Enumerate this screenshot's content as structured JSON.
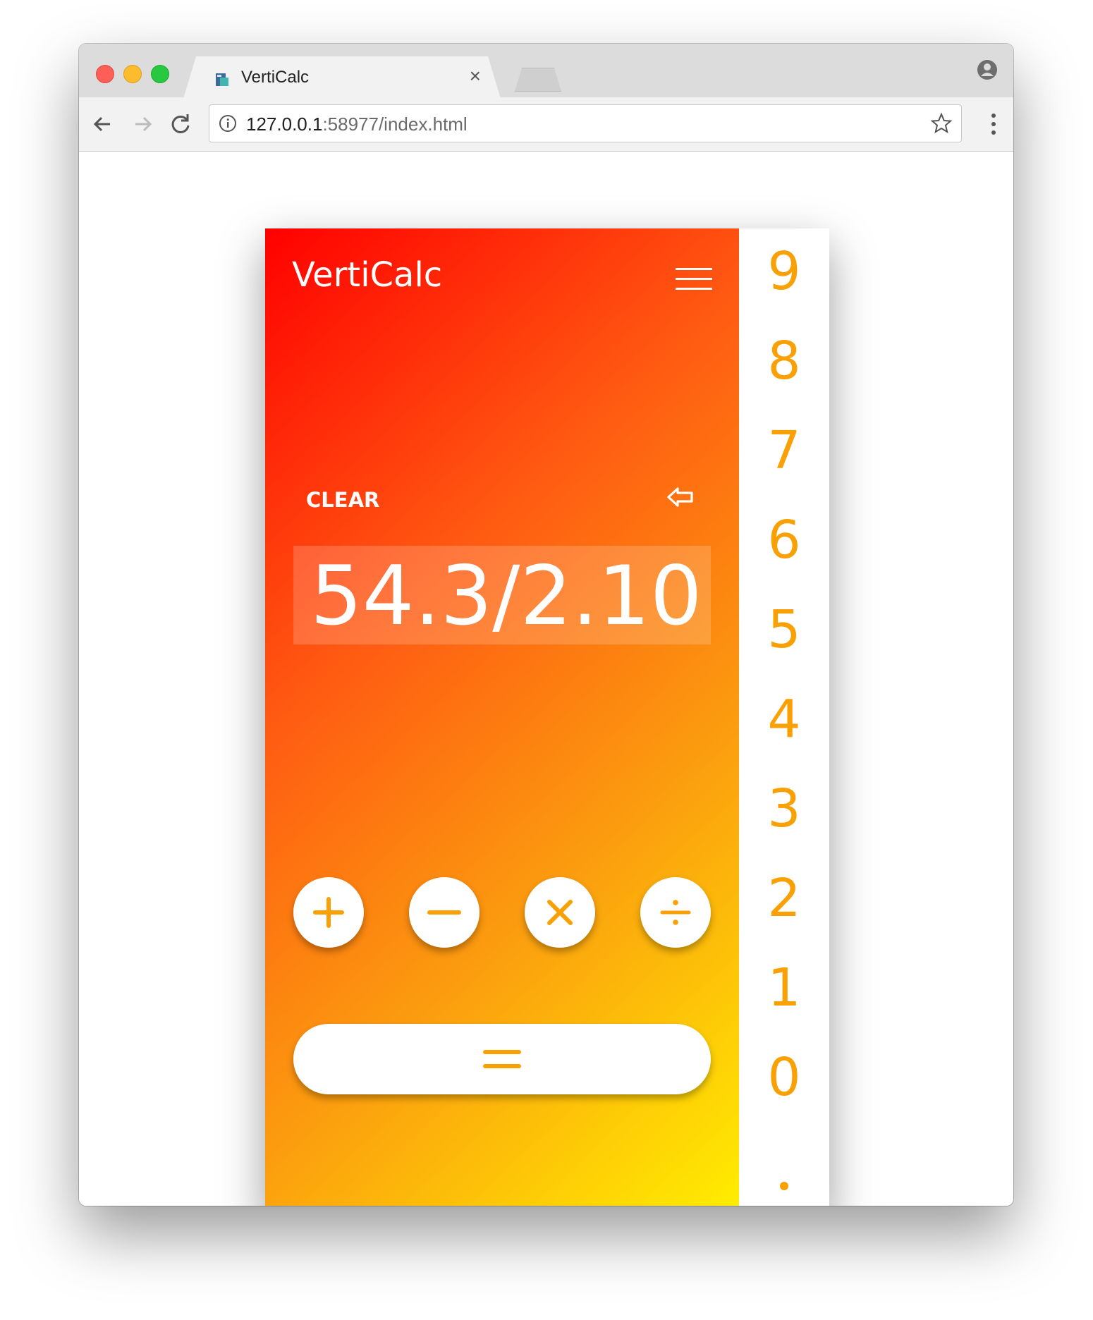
{
  "browser": {
    "tab_title": "VertiCalc",
    "tab_close": "×",
    "url_host": "127.0.0.1",
    "url_rest": ":58977/index.html"
  },
  "app": {
    "title": "VertiCalc",
    "clear_label": "CLEAR",
    "display_value": "54.3/2.10",
    "accent_color": "#f9a104",
    "gradient_colors": [
      "#ff0000",
      "#ff5a12",
      "#fb9c0f",
      "#ffee00"
    ],
    "operators": [
      "plus-icon",
      "minus-icon",
      "times-icon",
      "divide-icon"
    ],
    "equals_icon": "equals-icon",
    "keypad": {
      "digits": [
        "9",
        "8",
        "7",
        "6",
        "5",
        "4",
        "3",
        "2",
        "1",
        "0"
      ],
      "decimal": "."
    }
  }
}
